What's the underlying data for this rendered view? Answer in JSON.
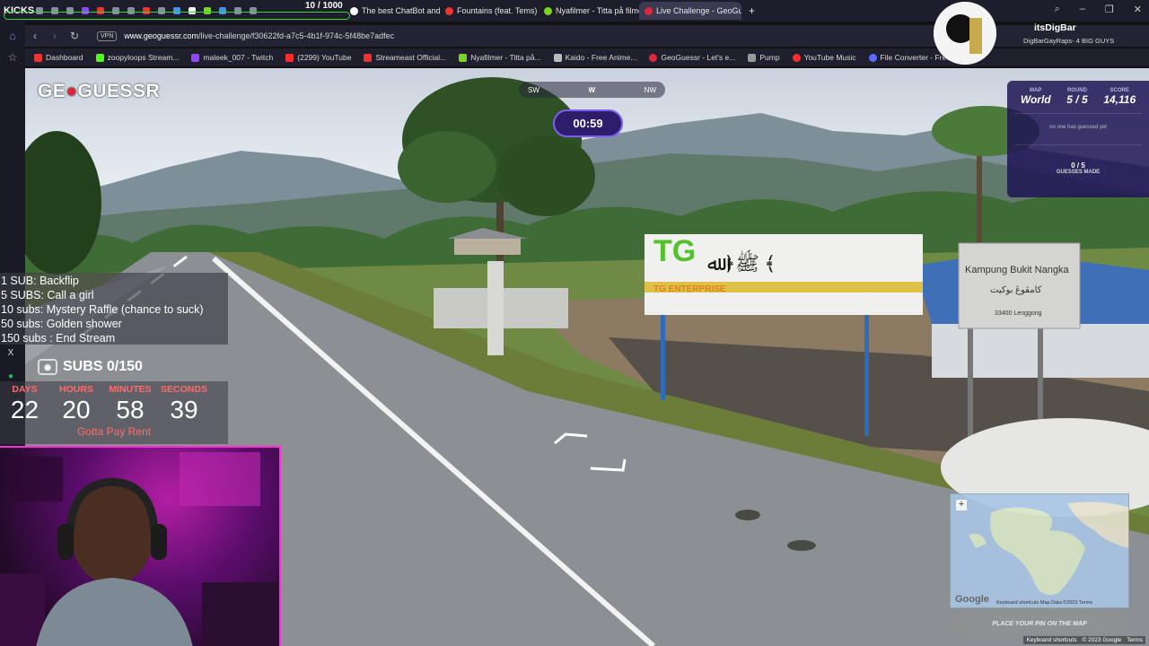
{
  "browser": {
    "kicks_label": "KICKS",
    "sub_goal": "10 / 1000",
    "tabs": [
      {
        "label": "The best ChatBot and Wi",
        "color": "#ffffff"
      },
      {
        "label": "Fountains (feat. Tems)",
        "color": "#e33"
      },
      {
        "label": "Nyafilmer - Titta på filmer",
        "color": "#7bd41e"
      },
      {
        "label": "Live Challenge - GeoGues",
        "color": "#e0263a"
      }
    ],
    "new_tab": "+",
    "url_host": "www.geoguessr.com",
    "url_path": "/live-challenge/f30622fd-a7c5-4b1f-974c-5f48be7adfec",
    "vpn": "VPN",
    "bookmarks": [
      {
        "label": "Dashboard",
        "color": "#e33"
      },
      {
        "label": "zoopyloops Stream...",
        "color": "#53fc18"
      },
      {
        "label": "maleek_007 - Twitch",
        "color": "#9146ff"
      },
      {
        "label": "(2299) YouTube",
        "color": "#ff2d2d"
      },
      {
        "label": "Streameast Official...",
        "color": "#e33"
      },
      {
        "label": "Nyafilmer - Titta på...",
        "color": "#7bd41e"
      },
      {
        "label": "Kaido - Free Anime...",
        "color": "#bbbbbb"
      },
      {
        "label": "GeoGuessr - Let's e...",
        "color": "#e0263a"
      },
      {
        "label": "Pump",
        "color": "#999999"
      },
      {
        "label": "YouTube Music",
        "color": "#ff2d2d"
      },
      {
        "label": "File Converter - Free...",
        "color": "#5c6bff"
      }
    ]
  },
  "game": {
    "logo_left": "GE",
    "logo_right": "GUESSR",
    "compass": {
      "left": "SW",
      "mid": "W",
      "right": "NW"
    },
    "timer": "00:59",
    "map_label": "MAP",
    "map_value": "World",
    "round_label": "ROUND",
    "round_value": "5 / 5",
    "score_label": "SCORE",
    "score_value": "14,116",
    "no_guess": "no one has guessed yet",
    "guesses_count": "0 / 5",
    "guesses_label": "GUESSES MADE",
    "pin_button": "PLACE YOUR PIN ON THE MAP",
    "minimap_plus": "+",
    "minimap_google": "Google",
    "minimap_attr": "Keyboard shortcuts   Map Data ©2023   Terms",
    "footer": [
      "Keyboard shortcuts",
      "© 2023 Google",
      "Terms"
    ],
    "sign_main": "Kampung Bukit  Nangka",
    "sign_sub": "33400 Lenggong",
    "billboard": "TG ENTERPRISE"
  },
  "stream": {
    "goals": [
      "1 SUB: Backflip",
      "5 SUBS: Call a girl",
      "10 subs: Mystery Raffle (chance to suck)",
      "50 subs: Golden shower",
      "150 subs : End Stream"
    ],
    "subs_text": "SUBS 0/150",
    "countdown": [
      {
        "label": "DAYS",
        "value": "22"
      },
      {
        "label": "HOURS",
        "value": "20"
      },
      {
        "label": "MINUTES",
        "value": "58"
      },
      {
        "label": "SECONDS",
        "value": "39"
      }
    ],
    "countdown_caption": "Gotta Pay Rent",
    "streamer_name": "itsDigBar",
    "streamer_title": "DigBarGayRaps- 4 BIG GUYS"
  }
}
